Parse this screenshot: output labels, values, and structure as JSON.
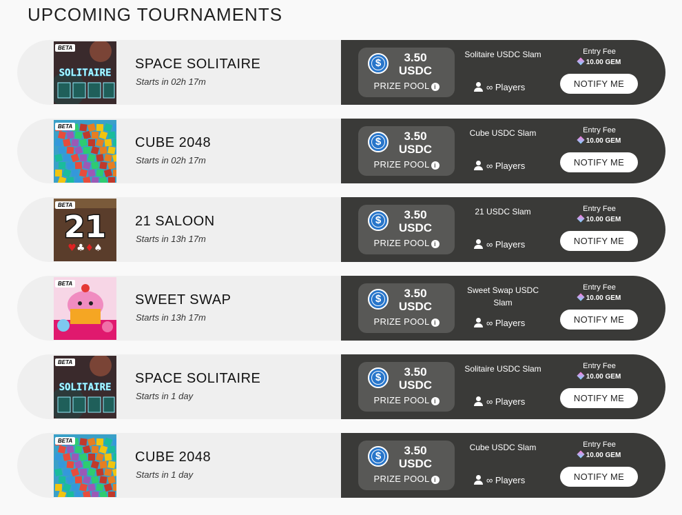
{
  "page": {
    "title": "UPCOMING TOURNAMENTS"
  },
  "tournaments": [
    {
      "game": "SPACE SOLITAIRE",
      "starts": "Starts in 02h 17m",
      "badge": "BETA",
      "art": "solitaire",
      "prize_amount": "3.50",
      "prize_currency": "USDC",
      "prize_label": "PRIZE POOL",
      "tournament_name": "Solitaire USDC Slam",
      "players": "∞ Players",
      "entry_fee_label": "Entry Fee",
      "entry_fee": "10.00 GEM",
      "notify_label": "NOTIFY ME"
    },
    {
      "game": "CUBE 2048",
      "starts": "Starts in 02h 17m",
      "badge": "BETA",
      "art": "cube",
      "prize_amount": "3.50",
      "prize_currency": "USDC",
      "prize_label": "PRIZE POOL",
      "tournament_name": "Cube USDC Slam",
      "players": "∞ Players",
      "entry_fee_label": "Entry Fee",
      "entry_fee": "10.00 GEM",
      "notify_label": "NOTIFY ME"
    },
    {
      "game": "21 SALOON",
      "starts": "Starts in 13h 17m",
      "badge": "BETA",
      "art": "saloon",
      "prize_amount": "3.50",
      "prize_currency": "USDC",
      "prize_label": "PRIZE POOL",
      "tournament_name": "21 USDC Slam",
      "players": "∞ Players",
      "entry_fee_label": "Entry Fee",
      "entry_fee": "10.00 GEM",
      "notify_label": "NOTIFY ME"
    },
    {
      "game": "SWEET SWAP",
      "starts": "Starts in 13h 17m",
      "badge": "BETA",
      "art": "sweet",
      "prize_amount": "3.50",
      "prize_currency": "USDC",
      "prize_label": "PRIZE POOL",
      "tournament_name": "Sweet Swap USDC Slam",
      "players": "∞ Players",
      "entry_fee_label": "Entry Fee",
      "entry_fee": "10.00 GEM",
      "notify_label": "NOTIFY ME"
    },
    {
      "game": "SPACE SOLITAIRE",
      "starts": "Starts in 1 day",
      "badge": "BETA",
      "art": "solitaire",
      "prize_amount": "3.50",
      "prize_currency": "USDC",
      "prize_label": "PRIZE POOL",
      "tournament_name": "Solitaire USDC Slam",
      "players": "∞ Players",
      "entry_fee_label": "Entry Fee",
      "entry_fee": "10.00 GEM",
      "notify_label": "NOTIFY ME"
    },
    {
      "game": "CUBE 2048",
      "starts": "Starts in 1 day",
      "badge": "BETA",
      "art": "cube",
      "prize_amount": "3.50",
      "prize_currency": "USDC",
      "prize_label": "PRIZE POOL",
      "tournament_name": "Cube USDC Slam",
      "players": "∞ Players",
      "entry_fee_label": "Entry Fee",
      "entry_fee": "10.00 GEM",
      "notify_label": "NOTIFY ME"
    }
  ],
  "art_text": {
    "solitaire": "SOLITAIRE",
    "saloon": "21"
  },
  "colors": {
    "usdc": "#2775ca",
    "panel": "#3a3a38",
    "row": "#efefef"
  },
  "icons": {
    "currency": "usdc-icon",
    "info": "info-icon",
    "players": "user-icon",
    "fee": "gem-icon"
  }
}
